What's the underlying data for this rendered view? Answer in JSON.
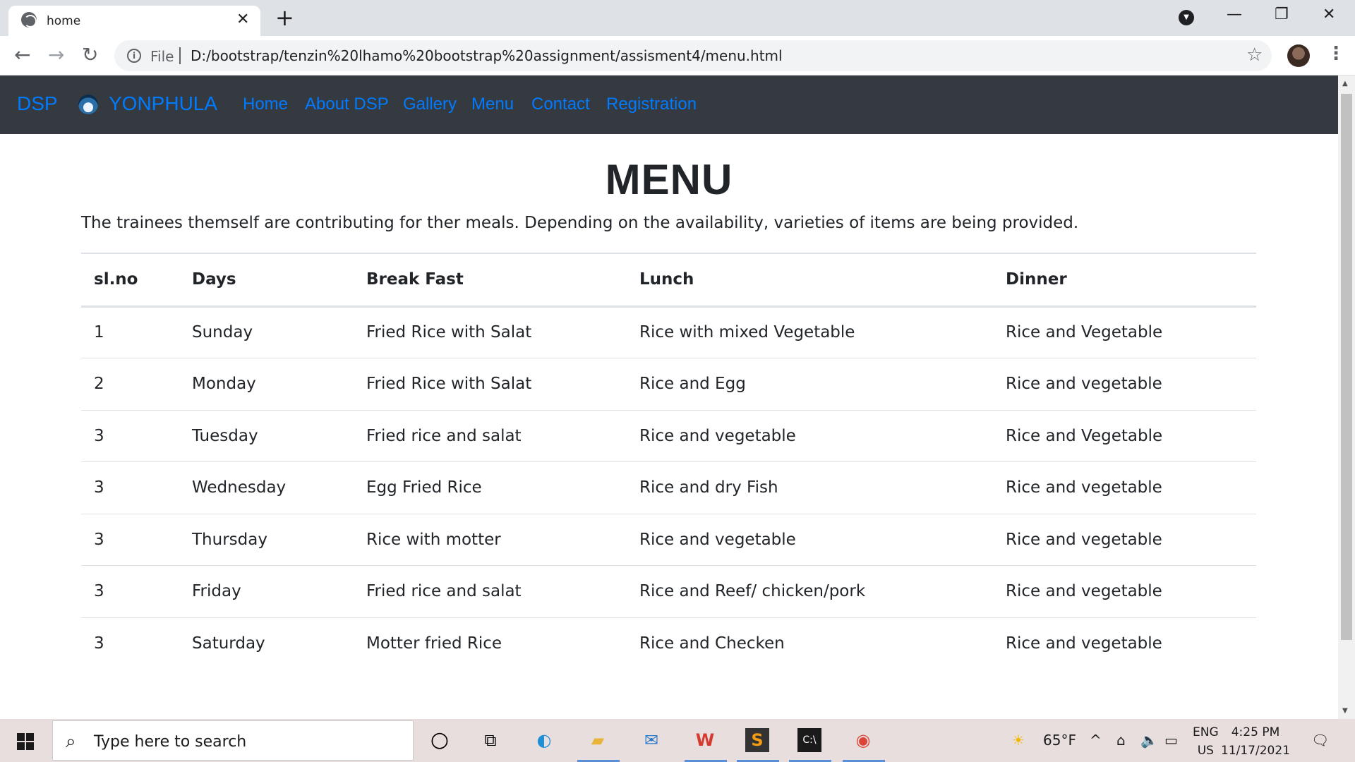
{
  "browser": {
    "tab_title": "home",
    "file_label": "File",
    "url": "D:/bootstrap/tenzin%20lhamo%20bootstrap%20assignment/assisment4/menu.html"
  },
  "navbar": {
    "brand": "DSP",
    "brand2": "YONPHULA",
    "links": [
      "Home",
      "About DSP",
      "Gallery",
      "Menu",
      "Contact",
      "Registration"
    ],
    "link_color": "#007bff",
    "bg_color": "#343a40"
  },
  "page": {
    "heading": "MENU",
    "lead": "The trainees themself are contributing for ther meals. Depending on the availability, varieties of items are being provided."
  },
  "table": {
    "headers": [
      "sl.no",
      "Days",
      "Break Fast",
      "Lunch",
      "Dinner"
    ],
    "rows": [
      [
        "1",
        "Sunday",
        "Fried Rice with Salat",
        "Rice with mixed Vegetable",
        "Rice and Vegetable"
      ],
      [
        "2",
        "Monday",
        "Fried Rice with Salat",
        "Rice and Egg",
        "Rice and vegetable"
      ],
      [
        "3",
        "Tuesday",
        "Fried rice and salat",
        "Rice and vegetable",
        "Rice and Vegetable"
      ],
      [
        "3",
        "Wednesday",
        "Egg Fried Rice",
        "Rice and dry Fish",
        "Rice and vegetable"
      ],
      [
        "3",
        "Thursday",
        "Rice with motter",
        "Rice and vegetable",
        "Rice and vegetable"
      ],
      [
        "3",
        "Friday",
        "Fried rice and salat",
        "Rice and Reef/ chicken/pork",
        "Rice and vegetable"
      ],
      [
        "3",
        "Saturday",
        "Motter fried Rice",
        "Rice and Checken",
        "Rice and vegetable"
      ]
    ]
  },
  "taskbar": {
    "search_placeholder": "Type here to search",
    "weather": "65°F",
    "lang_line1": "ENG",
    "lang_line2": "US",
    "time": "4:25 PM",
    "date": "11/17/2021"
  }
}
